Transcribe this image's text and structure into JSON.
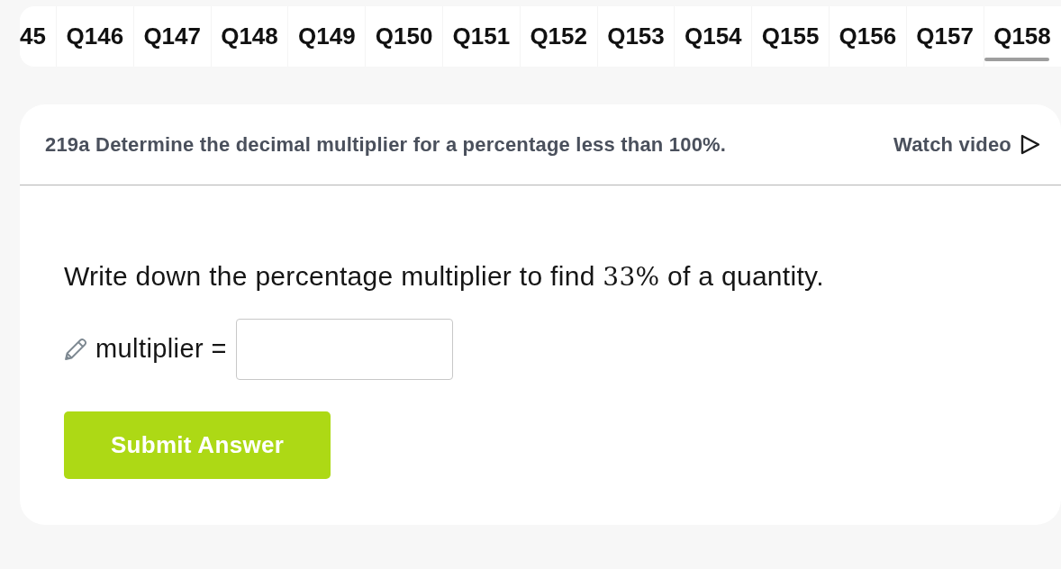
{
  "question_tabs": [
    {
      "label": "45",
      "selected": false
    },
    {
      "label": "Q146",
      "selected": false
    },
    {
      "label": "Q147",
      "selected": false
    },
    {
      "label": "Q148",
      "selected": false
    },
    {
      "label": "Q149",
      "selected": false
    },
    {
      "label": "Q150",
      "selected": false
    },
    {
      "label": "Q151",
      "selected": false
    },
    {
      "label": "Q152",
      "selected": false
    },
    {
      "label": "Q153",
      "selected": false
    },
    {
      "label": "Q154",
      "selected": false
    },
    {
      "label": "Q155",
      "selected": false
    },
    {
      "label": "Q156",
      "selected": false
    },
    {
      "label": "Q157",
      "selected": false
    },
    {
      "label": "Q158",
      "selected": true
    }
  ],
  "card": {
    "title": "219a Determine the decimal multiplier for a percentage less than 100%.",
    "watch_video": "Watch video"
  },
  "question": {
    "text_before": "Write down the percentage multiplier to find ",
    "math": "33%",
    "text_after": " of a quantity."
  },
  "answer": {
    "label": "multiplier ="
  },
  "submit_button": "Submit Answer"
}
